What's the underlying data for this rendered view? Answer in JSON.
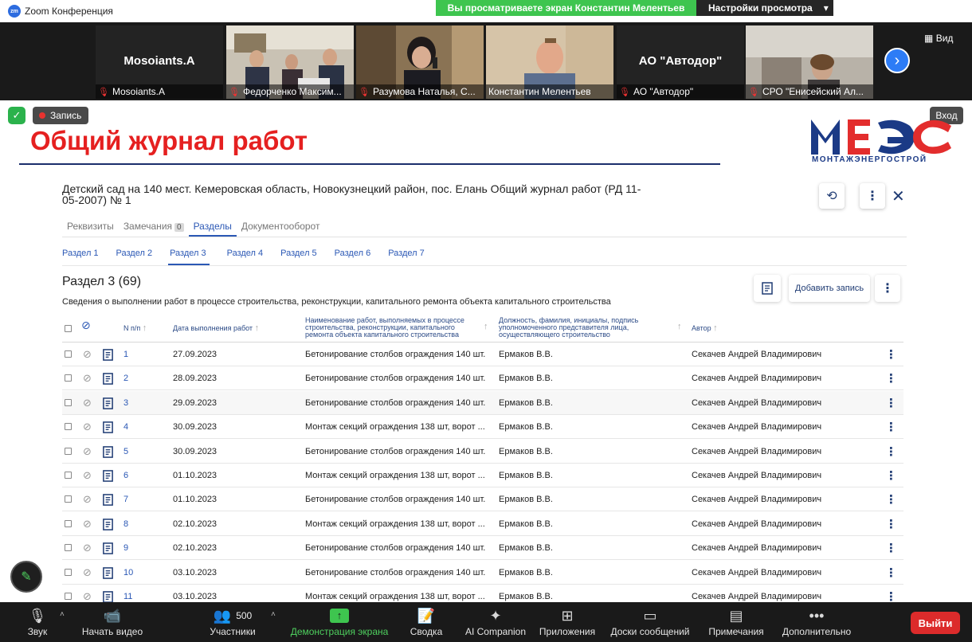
{
  "app": {
    "title": "Zoom Конференция",
    "logo_text": "zm"
  },
  "share_banner": {
    "text": "Вы просматриваете экран Константин Мелентьев",
    "settings_label": "Настройки просмотра",
    "settings_caret": "▾"
  },
  "participants_strip": {
    "view_label": "Вид",
    "tiles": [
      {
        "big_name": "Mosoiants.A",
        "name": "Mosoiants.A"
      },
      {
        "big_name": "",
        "name": "Федорченко Максим..."
      },
      {
        "big_name": "",
        "name": "Разумова Наталья, С..."
      },
      {
        "big_name": "",
        "name": "Константин Мелентьев"
      },
      {
        "big_name": "АО \"Автодор\"",
        "name": "АО \"Автодор\""
      },
      {
        "big_name": "",
        "name": "СРО \"Енисейский Ал..."
      }
    ]
  },
  "overlay": {
    "record_label": "Запись",
    "exit_label": "Вход"
  },
  "slide": {
    "title": "Общий журнал работ",
    "logo_main": "МЭС",
    "logo_sub": "МОНТАЖЭНЕРГОСТРОЙ"
  },
  "journal": {
    "title": "Детский сад на 140 мест. Кемеровская область, Новокузнецкий район, пос. Елань Общий журнал работ (РД 11-05-2007) № 1",
    "tabs": [
      {
        "label": "Реквизиты",
        "badge": ""
      },
      {
        "label": "Замечания",
        "badge": "0"
      },
      {
        "label": "Разделы",
        "badge": ""
      },
      {
        "label": "Документооборот",
        "badge": ""
      }
    ],
    "subtabs": [
      "Раздел 1",
      "Раздел 2",
      "Раздел 3",
      "Раздел 4",
      "Раздел 5",
      "Раздел 6",
      "Раздел 7"
    ],
    "section_title": "Раздел 3 (69)",
    "section_subtitle": "Сведения о выполнении работ в процессе строительства, реконструкции, капитального ремонта объекта капитального строительства",
    "add_record_label": "Добавить запись",
    "columns": {
      "num": "N п/п",
      "date": "Дата выполнения работ",
      "work": "Наименование работ, выполняемых в процессе строительства, реконструкции, капитального ремонта объекта капитального строительства",
      "person": "Должность, фамилия, инициалы, подпись уполномоченного представителя лица, осуществляющего строительство",
      "author": "Автор"
    },
    "rows": [
      {
        "num": "1",
        "date": "27.09.2023",
        "work": "Бетонирование столбов ограждения 140 шт.",
        "person": "Ермаков В.В.",
        "author": "Секачев Андрей Владимирович"
      },
      {
        "num": "2",
        "date": "28.09.2023",
        "work": "Бетонирование столбов ограждения 140 шт.",
        "person": "Ермаков В.В.",
        "author": "Секачев Андрей Владимирович"
      },
      {
        "num": "3",
        "date": "29.09.2023",
        "work": "Бетонирование столбов ограждения 140 шт.",
        "person": "Ермаков В.В.",
        "author": "Секачев Андрей Владимирович"
      },
      {
        "num": "4",
        "date": "30.09.2023",
        "work": "Монтаж секций ограждения 138 шт, ворот ...",
        "person": "Ермаков В.В.",
        "author": "Секачев Андрей Владимирович"
      },
      {
        "num": "5",
        "date": "30.09.2023",
        "work": "Бетонирование столбов ограждения 140 шт.",
        "person": "Ермаков В.В.",
        "author": "Секачев Андрей Владимирович"
      },
      {
        "num": "6",
        "date": "01.10.2023",
        "work": "Монтаж секций ограждения 138 шт, ворот ...",
        "person": "Ермаков В.В.",
        "author": "Секачев Андрей Владимирович"
      },
      {
        "num": "7",
        "date": "01.10.2023",
        "work": "Бетонирование столбов ограждения 140 шт.",
        "person": "Ермаков В.В.",
        "author": "Секачев Андрей Владимирович"
      },
      {
        "num": "8",
        "date": "02.10.2023",
        "work": "Монтаж секций ограждения 138 шт, ворот ...",
        "person": "Ермаков В.В.",
        "author": "Секачев Андрей Владимирович"
      },
      {
        "num": "9",
        "date": "02.10.2023",
        "work": "Бетонирование столбов ограждения 140 шт.",
        "person": "Ермаков В.В.",
        "author": "Секачев Андрей Владимирович"
      },
      {
        "num": "10",
        "date": "03.10.2023",
        "work": "Бетонирование столбов ограждения 140 шт.",
        "person": "Ермаков В.В.",
        "author": "Секачев Андрей Владимирович"
      },
      {
        "num": "11",
        "date": "03.10.2023",
        "work": "Монтаж секций ограждения 138 шт, ворот ...",
        "person": "Ермаков В.В.",
        "author": "Секачев Андрей Владимирович"
      }
    ]
  },
  "toolbar": {
    "audio": "Звук",
    "video": "Начать видео",
    "participants": "Участники",
    "participants_count": "500",
    "share": "Демонстрация экрана",
    "summary": "Сводка",
    "ai": "AI Companion",
    "apps": "Приложения",
    "boards": "Доски сообщений",
    "notes": "Примечания",
    "more": "Дополнительно",
    "leave": "Выйти"
  },
  "colors": {
    "accent": "#2b58b5",
    "title_red": "#e52020",
    "banner_green": "#3ec54f",
    "leave_red": "#dc2b2b"
  }
}
